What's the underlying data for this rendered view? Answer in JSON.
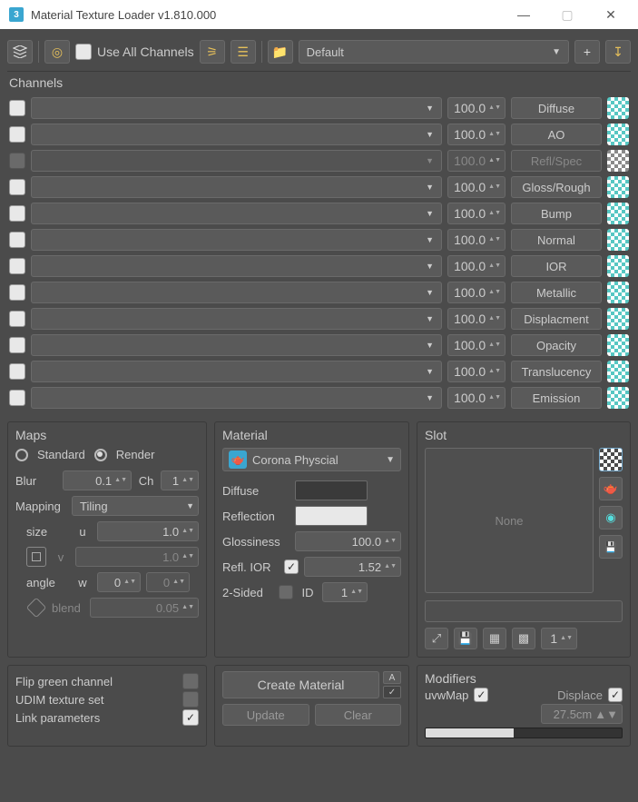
{
  "window": {
    "title": "Material Texture Loader v1.810.000"
  },
  "toolbar": {
    "use_all_channels": "Use All Channels",
    "preset": "Default"
  },
  "channels_label": "Channels",
  "channels": [
    {
      "enabled": true,
      "value": "100.0",
      "label": "Diffuse"
    },
    {
      "enabled": true,
      "value": "100.0",
      "label": "AO"
    },
    {
      "enabled": false,
      "value": "100.0",
      "label": "Refl/Spec"
    },
    {
      "enabled": true,
      "value": "100.0",
      "label": "Gloss/Rough"
    },
    {
      "enabled": true,
      "value": "100.0",
      "label": "Bump"
    },
    {
      "enabled": true,
      "value": "100.0",
      "label": "Normal"
    },
    {
      "enabled": true,
      "value": "100.0",
      "label": "IOR"
    },
    {
      "enabled": true,
      "value": "100.0",
      "label": "Metallic"
    },
    {
      "enabled": true,
      "value": "100.0",
      "label": "Displacment"
    },
    {
      "enabled": true,
      "value": "100.0",
      "label": "Opacity"
    },
    {
      "enabled": true,
      "value": "100.0",
      "label": "Translucency"
    },
    {
      "enabled": true,
      "value": "100.0",
      "label": "Emission"
    }
  ],
  "maps": {
    "label": "Maps",
    "standard": "Standard",
    "render": "Render",
    "blur_l": "Blur",
    "blur": "0.1",
    "ch_l": "Ch",
    "ch": "1",
    "mapping_l": "Mapping",
    "mapping": "Tiling",
    "size_l": "size",
    "u_l": "u",
    "u": "1.0",
    "v_l": "v",
    "v": "1.0",
    "angle_l": "angle",
    "w_l": "w",
    "w": "0",
    "w2": "0",
    "blend_l": "blend",
    "blend": "0.05"
  },
  "material": {
    "label": "Material",
    "type": "Corona Physcial",
    "diffuse_l": "Diffuse",
    "reflection_l": "Reflection",
    "gloss_l": "Glossiness",
    "gloss": "100.0",
    "ior_l": "Refl. IOR",
    "ior": "1.52",
    "twosided_l": "2-Sided",
    "id_l": "ID",
    "id": "1"
  },
  "slot": {
    "label": "Slot",
    "none": "None",
    "count": "1"
  },
  "options": {
    "flip": "Flip green channel",
    "udim": "UDIM texture set",
    "link": "Link parameters"
  },
  "actions": {
    "create": "Create Material",
    "a": "A",
    "update": "Update",
    "clear": "Clear"
  },
  "modifiers": {
    "label": "Modifiers",
    "uvw": "uvwMap",
    "disp": "Displace",
    "dist": "27.5cm"
  }
}
